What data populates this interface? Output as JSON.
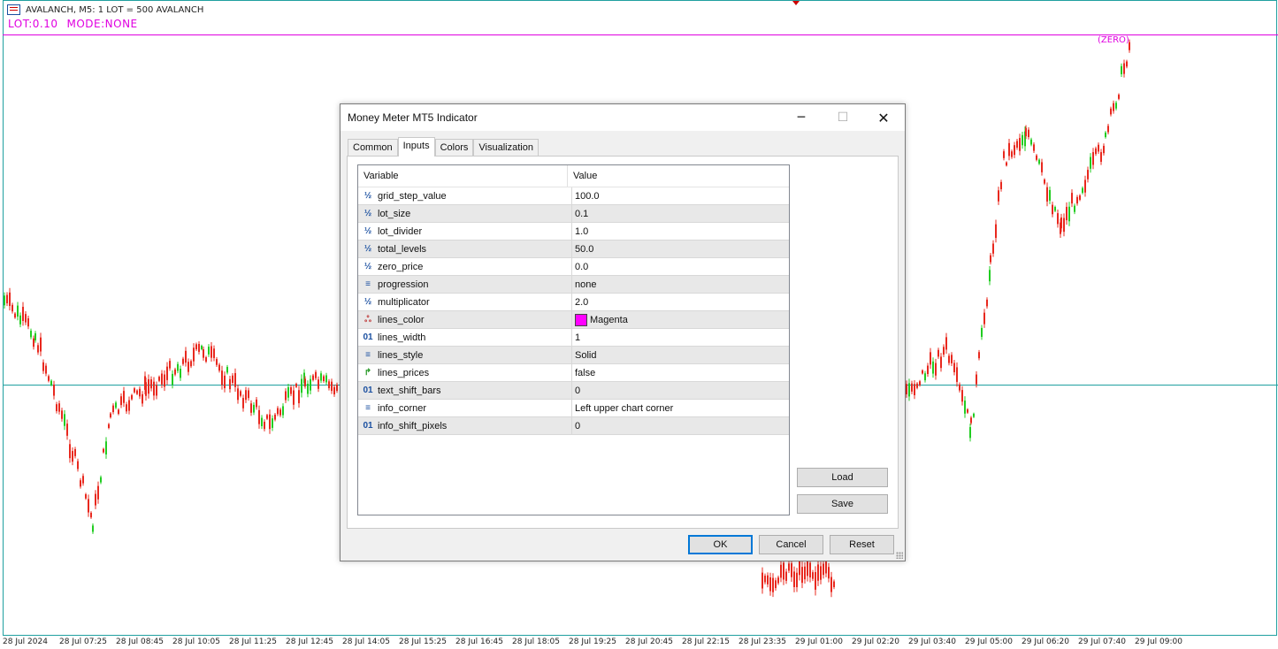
{
  "chart": {
    "title": "AVALANCH, M5:  1 LOT = 500 AVALANCH",
    "info": {
      "lot": "LOT:0.10",
      "mode": "MODE:NONE"
    },
    "zero_label": "(ZERO)",
    "time_labels": [
      "28 Jul 2024",
      "28 Jul 07:25",
      "28 Jul 08:45",
      "28 Jul 10:05",
      "28 Jul 11:25",
      "28 Jul 12:45",
      "28 Jul 14:05",
      "28 Jul 15:25",
      "28 Jul 16:45",
      "28 Jul 18:05",
      "28 Jul 19:25",
      "28 Jul 20:45",
      "28 Jul 22:15",
      "28 Jul 23:35",
      "29 Jul 01:00",
      "29 Jul 02:20",
      "29 Jul 03:40",
      "29 Jul 05:00",
      "29 Jul 06:20",
      "29 Jul 07:40",
      "29 Jul 09:00"
    ],
    "colors": {
      "bear": "#e8281e",
      "bull": "#22cc22",
      "zero_line": "#e000e0",
      "price_line": "#20a0a0"
    }
  },
  "dialog": {
    "title": "Money Meter MT5 Indicator",
    "tabs": [
      "Common",
      "Inputs",
      "Colors",
      "Visualization"
    ],
    "active_tab": "Inputs",
    "columns": {
      "variable": "Variable",
      "value": "Value"
    },
    "rows": [
      {
        "icon": "half-icon",
        "glyph": "½",
        "name": "grid_step_value",
        "value": "100.0"
      },
      {
        "icon": "half-icon",
        "glyph": "½",
        "name": "lot_size",
        "value": "0.1"
      },
      {
        "icon": "half-icon",
        "glyph": "½",
        "name": "lot_divider",
        "value": "1.0"
      },
      {
        "icon": "half-icon",
        "glyph": "½",
        "name": "total_levels",
        "value": "50.0"
      },
      {
        "icon": "half-icon",
        "glyph": "½",
        "name": "zero_price",
        "value": "0.0"
      },
      {
        "icon": "enum-icon",
        "glyph": "≡",
        "name": "progression",
        "value": "none"
      },
      {
        "icon": "half-icon",
        "glyph": "½",
        "name": "multiplicator",
        "value": "2.0"
      },
      {
        "icon": "color-icon",
        "glyph": "ஃ",
        "name": "lines_color",
        "value": "Magenta",
        "swatch": "#ff00ff"
      },
      {
        "icon": "int-icon",
        "glyph": "01",
        "name": "lines_width",
        "value": "1"
      },
      {
        "icon": "enum-icon",
        "glyph": "≡",
        "name": "lines_style",
        "value": "Solid"
      },
      {
        "icon": "bool-icon",
        "glyph": "↱",
        "name": "lines_prices",
        "value": "false"
      },
      {
        "icon": "int-icon",
        "glyph": "01",
        "name": "text_shift_bars",
        "value": "0"
      },
      {
        "icon": "enum-icon",
        "glyph": "≡",
        "name": "info_corner",
        "value": "Left upper chart corner"
      },
      {
        "icon": "int-icon",
        "glyph": "01",
        "name": "info_shift_pixels",
        "value": "0"
      }
    ],
    "buttons": {
      "load": "Load",
      "save": "Save",
      "ok": "OK",
      "cancel": "Cancel",
      "reset": "Reset"
    },
    "window_controls": {
      "minimize": "─",
      "maximize": "☐",
      "close": "✕"
    }
  }
}
